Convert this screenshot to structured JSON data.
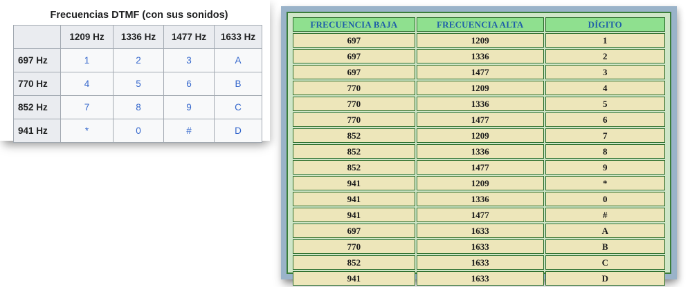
{
  "keypad_table": {
    "title": "Frecuencias DTMF (con sus sonidos)",
    "column_headers": [
      "1209 Hz",
      "1336 Hz",
      "1477 Hz",
      "1633 Hz"
    ],
    "rows": [
      {
        "label": "697 Hz",
        "cells": [
          "1",
          "2",
          "3",
          "A"
        ]
      },
      {
        "label": "770 Hz",
        "cells": [
          "4",
          "5",
          "6",
          "B"
        ]
      },
      {
        "label": "852 Hz",
        "cells": [
          "7",
          "8",
          "9",
          "C"
        ]
      },
      {
        "label": "941 Hz",
        "cells": [
          "*",
          "0",
          "#",
          "D"
        ]
      }
    ]
  },
  "frequency_table": {
    "headers": [
      "FRECUENCIA BAJA",
      "FRECUENCIA ALTA",
      "DÍGITO"
    ],
    "rows": [
      [
        "697",
        "1209",
        "1"
      ],
      [
        "697",
        "1336",
        "2"
      ],
      [
        "697",
        "1477",
        "3"
      ],
      [
        "770",
        "1209",
        "4"
      ],
      [
        "770",
        "1336",
        "5"
      ],
      [
        "770",
        "1477",
        "6"
      ],
      [
        "852",
        "1209",
        "7"
      ],
      [
        "852",
        "1336",
        "8"
      ],
      [
        "852",
        "1477",
        "9"
      ],
      [
        "941",
        "1209",
        "*"
      ],
      [
        "941",
        "1336",
        "0"
      ],
      [
        "941",
        "1477",
        "#"
      ],
      [
        "697",
        "1633",
        "A"
      ],
      [
        "770",
        "1633",
        "B"
      ],
      [
        "852",
        "1633",
        "C"
      ],
      [
        "941",
        "1633",
        "D"
      ]
    ]
  },
  "colors": {
    "header_green": "#8fe08f",
    "cell_beige": "#ede6ba",
    "border_green": "#2c6e2c",
    "header_text_blue": "#1f5fa8",
    "link_blue": "#3366cc",
    "frame_blue": "#9ab3c9"
  }
}
